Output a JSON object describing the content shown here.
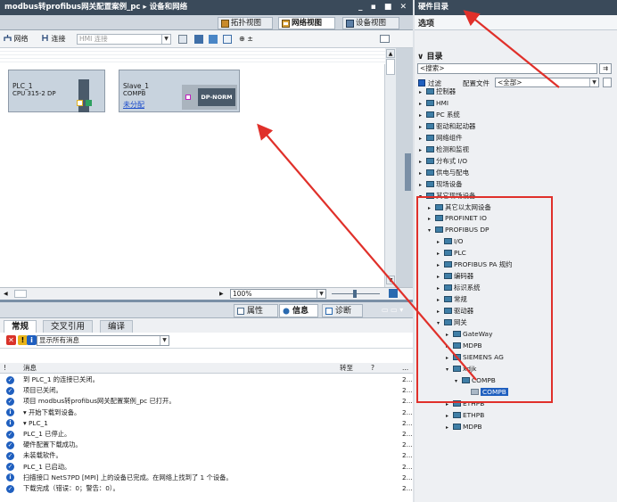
{
  "title": {
    "text": "modbus转profibus网关配置案例_pc ▸ 设备和网络",
    "controls": "_ ▪ ■ ✕"
  },
  "right_title": "硬件目录",
  "view_tabs": [
    "拓扑视图",
    "网络视图",
    "设备视图"
  ],
  "toolbar": {
    "network": "网络",
    "connect": "连接",
    "hmi_connection": "HMI 连接",
    "zoom": "⊕ ±"
  },
  "devices": {
    "plc": {
      "name": "PLC_1",
      "type": "CPU 315-2 DP"
    },
    "slave": {
      "name": "Slave_1",
      "type": "COMPB",
      "link": "未分配",
      "module": "DP-NORM"
    }
  },
  "zoom": "100%",
  "prop_tabs": [
    "属性",
    "信息",
    "诊断"
  ],
  "sub_tabs": [
    "常规",
    "交叉引用",
    "编译"
  ],
  "filter": {
    "value": "显示所有消息"
  },
  "msg_head": {
    "message": "消息",
    "goto": "转至",
    "q": "?",
    "dots": "..."
  },
  "messages": [
    {
      "icon": "ok",
      "text": "到 PLC_1 的连接已关闭。",
      "date": "2..."
    },
    {
      "icon": "ok",
      "text": "项目已关闭。",
      "date": "2..."
    },
    {
      "icon": "ok",
      "text": "项目 modbus转profibus网关配置案例_pc 已打开。",
      "date": "2..."
    },
    {
      "icon": "info",
      "text": "▾  开始下载到设备。",
      "date": "2..."
    },
    {
      "icon": "info",
      "text": "   ▾  PLC_1",
      "date": "2..."
    },
    {
      "icon": "ok",
      "text": "          PLC_1 已停止。",
      "date": "2..."
    },
    {
      "icon": "ok",
      "text": "          硬件配置下载成功。",
      "date": "2..."
    },
    {
      "icon": "ok",
      "text": "          未装载软件。",
      "date": "2..."
    },
    {
      "icon": "ok",
      "text": "          PLC_1 已启动。",
      "date": "2..."
    },
    {
      "icon": "info",
      "text": "扫描接口 NetS7PD [MPI] 上的设备已完成。在网络上找到了 1 个设备。",
      "date": "2..."
    },
    {
      "icon": "ok",
      "text": "下载完成（错误：0；警告：0）。",
      "date": "2..."
    }
  ],
  "right": {
    "options": "选项",
    "catalog": "目录",
    "search_placeholder": "<搜索>",
    "filter_label": "过滤",
    "profile_label": "配置文件",
    "profile_value": "<全部>",
    "side_label": "硬件目录"
  },
  "tree": [
    {
      "depth": 0,
      "open": false,
      "label": "控制器"
    },
    {
      "depth": 0,
      "open": false,
      "label": "HMI"
    },
    {
      "depth": 0,
      "open": false,
      "label": "PC 系统"
    },
    {
      "depth": 0,
      "open": false,
      "label": "驱动和起动器"
    },
    {
      "depth": 0,
      "open": false,
      "label": "网络组件"
    },
    {
      "depth": 0,
      "open": false,
      "label": "检测和监视"
    },
    {
      "depth": 0,
      "open": false,
      "label": "分布式 I/O"
    },
    {
      "depth": 0,
      "open": false,
      "label": "供电与配电"
    },
    {
      "depth": 0,
      "open": false,
      "label": "现场设备"
    },
    {
      "depth": 0,
      "open": true,
      "label": "其它现场设备"
    },
    {
      "depth": 1,
      "open": false,
      "label": "其它以太网设备"
    },
    {
      "depth": 1,
      "open": false,
      "label": "PROFINET IO"
    },
    {
      "depth": 1,
      "open": true,
      "label": "PROFIBUS DP"
    },
    {
      "depth": 2,
      "open": false,
      "label": "I/O"
    },
    {
      "depth": 2,
      "open": false,
      "label": "PLC"
    },
    {
      "depth": 2,
      "open": false,
      "label": "PROFIBUS PA 规约"
    },
    {
      "depth": 2,
      "open": false,
      "label": "编码器"
    },
    {
      "depth": 2,
      "open": false,
      "label": "标识系统"
    },
    {
      "depth": 2,
      "open": false,
      "label": "常规"
    },
    {
      "depth": 2,
      "open": false,
      "label": "驱动器"
    },
    {
      "depth": 2,
      "open": true,
      "label": "网关"
    },
    {
      "depth": 3,
      "open": false,
      "label": "GateWay"
    },
    {
      "depth": 3,
      "open": false,
      "label": "MDPB"
    },
    {
      "depth": 3,
      "open": false,
      "label": "SIEMENS AG"
    },
    {
      "depth": 3,
      "open": true,
      "label": "xdjk"
    },
    {
      "depth": 4,
      "open": true,
      "label": "COMPB"
    },
    {
      "depth": 5,
      "open": null,
      "label": "COMPB",
      "selected": true
    },
    {
      "depth": 3,
      "open": false,
      "label": "ETHPB"
    },
    {
      "depth": 3,
      "open": false,
      "label": "ETHPB"
    },
    {
      "depth": 3,
      "open": false,
      "label": "MDPB"
    }
  ],
  "colors": {
    "accent": "#e0302a",
    "title_bg": "#3a4a5a",
    "select": "#1f5fbf"
  }
}
